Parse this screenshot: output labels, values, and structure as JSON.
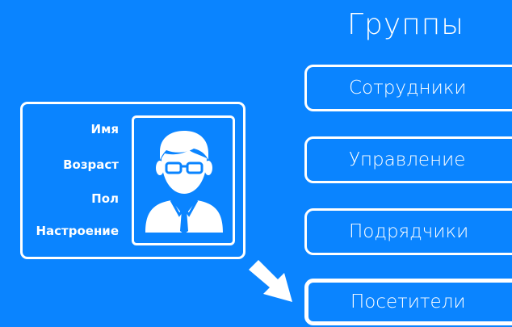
{
  "groups": {
    "title": "Группы",
    "items": [
      {
        "label": "Сотрудники"
      },
      {
        "label": "Управление"
      },
      {
        "label": "Подрядчики"
      },
      {
        "label": "Посетители",
        "active": true
      }
    ]
  },
  "profile_card": {
    "fields": [
      "Имя",
      "Возраст",
      "Пол",
      "Настроение"
    ],
    "avatar_icon": "person-with-glasses-icon"
  },
  "arrow_icon": "arrow-down-right-icon",
  "colors": {
    "background": "#0a84ff",
    "foreground": "#ffffff"
  }
}
